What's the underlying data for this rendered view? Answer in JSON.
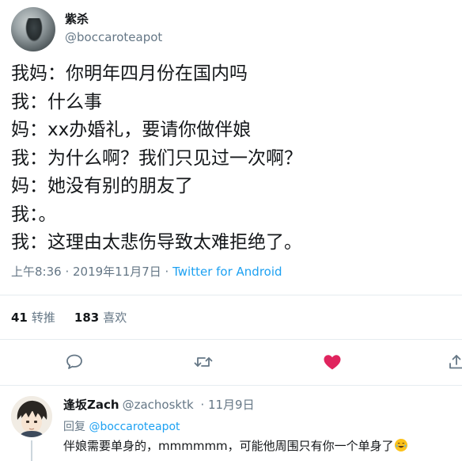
{
  "tweet": {
    "author": {
      "display_name": "紫杀",
      "handle": "@boccaroteapot"
    },
    "lines": [
      "我妈：你明年四月份在国内吗",
      "我：什么事",
      "妈：xx办婚礼，要请你做伴娘",
      "我：为什么啊？我们只见过一次啊？",
      "妈：她没有别的朋友了",
      "我：。",
      "我：这理由太悲伤导致太难拒绝了。"
    ],
    "timestamp": "上午8:36 · 2019年11月7日 · ",
    "source": "Twitter for Android",
    "stats": {
      "retweets_count": "41",
      "retweets_label": "转推",
      "likes_count": "183",
      "likes_label": "喜欢"
    },
    "actions": {
      "reply_icon": "speech-bubble-icon",
      "retweet_icon": "retweet-arrows-icon",
      "like_icon": "heart-icon",
      "like_color": "#e0245e",
      "share_icon": "share-icon"
    }
  },
  "reply": {
    "display_name": "逢坂Zach",
    "handle": "@zachosktk",
    "date": "· 11月9日",
    "replying_prefix": "回复",
    "replying_to": "@boccaroteapot",
    "text": "伴娘需要单身的，mmmmmm，可能他周围只有你一个单身了",
    "emoji": "face-with-tears-of-joy"
  },
  "colors": {
    "text": "#14171a",
    "secondary": "#657786",
    "link": "#1da1f2",
    "like": "#e0245e",
    "divider": "#e6ecf0"
  }
}
